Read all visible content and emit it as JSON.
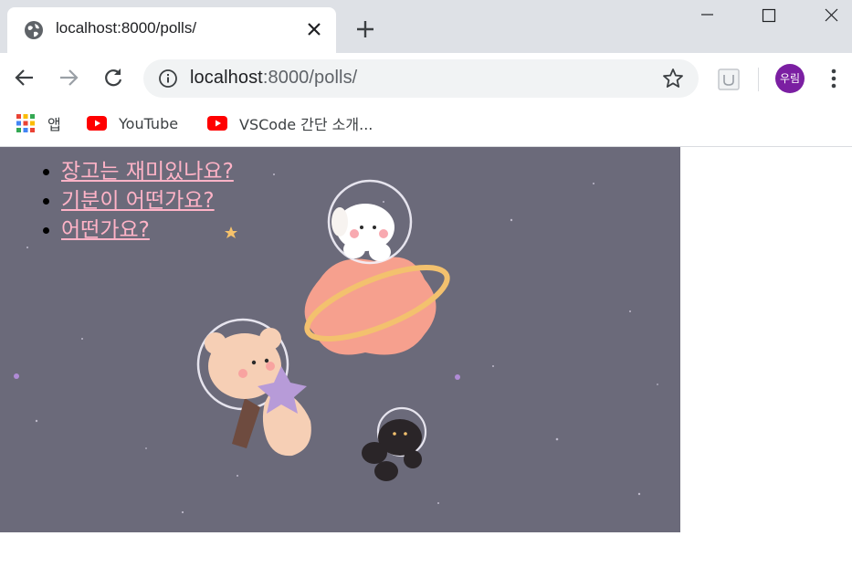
{
  "tab": {
    "title": "localhost:8000/polls/"
  },
  "address": {
    "host": "localhost",
    "rest": ":8000/polls/"
  },
  "bookmarks": [
    {
      "label": "앱",
      "icon": "apps-grid-icon"
    },
    {
      "label": "YouTube",
      "icon": "youtube-icon"
    },
    {
      "label": "VSCode 간단 소개...",
      "icon": "youtube-icon"
    }
  ],
  "profile": {
    "initials": "우림",
    "color": "#7b1fa2"
  },
  "polls": [
    {
      "question": "장고는 재미있나요?"
    },
    {
      "question": "기분이 어떤가요?"
    },
    {
      "question": "어떤가요?"
    }
  ],
  "colors": {
    "link": "#ffb3c7",
    "background_art": "#6b6a7a"
  }
}
